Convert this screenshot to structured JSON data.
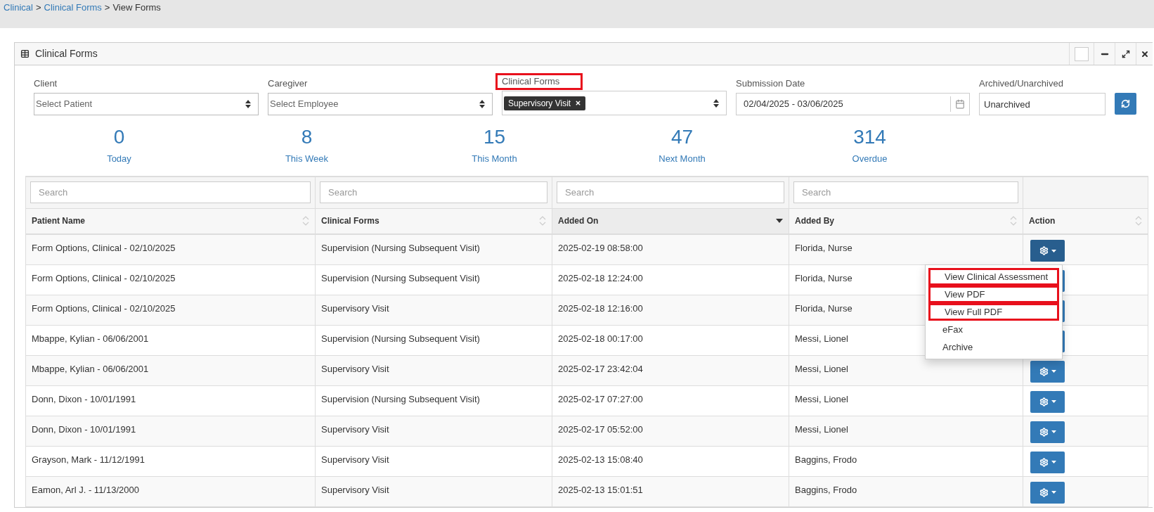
{
  "breadcrumb": [
    {
      "label": "Clinical",
      "link": true
    },
    {
      "separator": ">",
      "label": "Clinical Forms",
      "link": true
    },
    {
      "separator": ">",
      "label": "View Forms",
      "link": false
    }
  ],
  "panel": {
    "title": "Clinical Forms"
  },
  "filters": [
    {
      "kind": "select",
      "label": "Client",
      "placeholder": "Select Patient",
      "highlighted": false
    },
    {
      "kind": "select",
      "label": "Caregiver",
      "placeholder": "Select Employee",
      "highlighted": false
    },
    {
      "kind": "tags",
      "label": "Clinical Forms",
      "tags": [
        "Supervisory Visit"
      ],
      "highlighted": true
    },
    {
      "kind": "date",
      "label": "Submission Date",
      "value": "02/04/2025 - 03/06/2025",
      "highlighted": false
    },
    {
      "kind": "text",
      "label": "Archived/Unarchived",
      "value": "Unarchived",
      "highlighted": false
    }
  ],
  "stats": [
    {
      "count": "0",
      "label": "Today"
    },
    {
      "count": "8",
      "label": "This Week"
    },
    {
      "count": "15",
      "label": "This Month"
    },
    {
      "count": "47",
      "label": "Next Month"
    },
    {
      "count": "314",
      "label": "Overdue"
    }
  ],
  "table": {
    "search_placeholders": [
      "Search",
      "Search",
      "Search",
      "Search"
    ],
    "columns": [
      {
        "label": "Patient Name",
        "sorted": false
      },
      {
        "label": "Clinical Forms",
        "sorted": false
      },
      {
        "label": "Added On",
        "sorted": true
      },
      {
        "label": "Added By",
        "sorted": false
      },
      {
        "label": "Action",
        "sorted": false
      }
    ],
    "rows": [
      {
        "cells": [
          "Form Options, Clinical - 02/10/2025",
          "Supervision (Nursing Subsequent Visit)",
          "2025-02-19 08:58:00",
          "Florida, Nurse"
        ],
        "menu_open": true
      },
      {
        "cells": [
          "Form Options, Clinical - 02/10/2025",
          "Supervision (Nursing Subsequent Visit)",
          "2025-02-18 12:24:00",
          "Florida, Nurse"
        ],
        "menu_open": false
      },
      {
        "cells": [
          "Form Options, Clinical - 02/10/2025",
          "Supervisory Visit",
          "2025-02-18 12:16:00",
          "Florida, Nurse"
        ],
        "menu_open": false
      },
      {
        "cells": [
          "Mbappe, Kylian - 06/06/2001",
          "Supervision (Nursing Subsequent Visit)",
          "2025-02-18 00:17:00",
          "Messi, Lionel"
        ],
        "menu_open": false
      },
      {
        "cells": [
          "Mbappe, Kylian - 06/06/2001",
          "Supervisory Visit",
          "2025-02-17 23:42:04",
          "Messi, Lionel"
        ],
        "menu_open": false
      },
      {
        "cells": [
          "Donn, Dixon - 10/01/1991",
          "Supervision (Nursing Subsequent Visit)",
          "2025-02-17 07:27:00",
          "Messi, Lionel"
        ],
        "menu_open": false
      },
      {
        "cells": [
          "Donn, Dixon - 10/01/1991",
          "Supervisory Visit",
          "2025-02-17 05:52:00",
          "Messi, Lionel"
        ],
        "menu_open": false
      },
      {
        "cells": [
          "Grayson, Mark - 11/12/1991",
          "Supervisory Visit",
          "2025-02-13 15:08:40",
          "Baggins, Frodo"
        ],
        "menu_open": false
      },
      {
        "cells": [
          "Eamon, Arl J. - 11/13/2000",
          "Supervisory Visit",
          "2025-02-13 15:01:51",
          "Baggins, Frodo"
        ],
        "menu_open": false
      }
    ]
  },
  "action_menu": [
    {
      "label": "View Clinical Assessment",
      "highlighted": true
    },
    {
      "label": "View PDF",
      "highlighted": true
    },
    {
      "label": "View Full PDF",
      "highlighted": true
    },
    {
      "label": "eFax",
      "highlighted": false
    },
    {
      "label": "Archive",
      "highlighted": false
    }
  ]
}
